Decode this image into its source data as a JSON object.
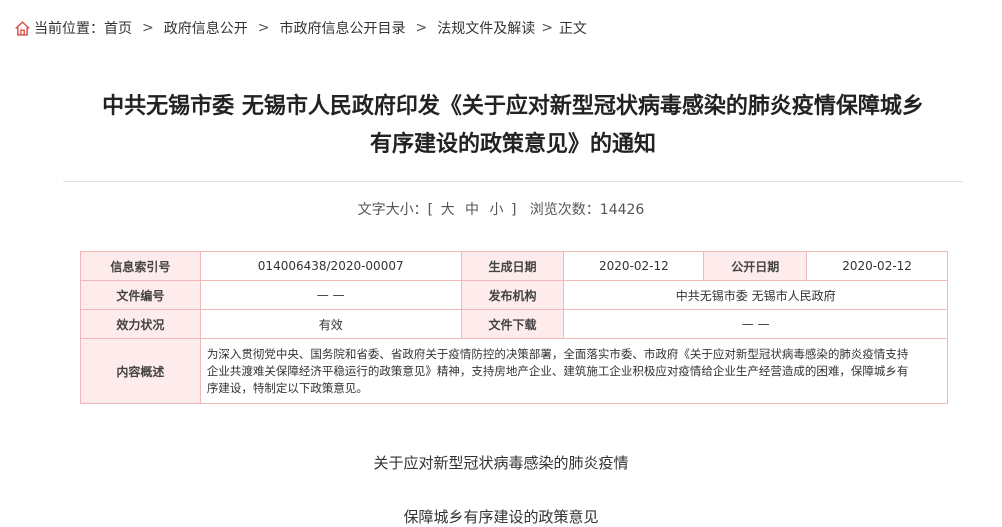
{
  "breadcrumb": {
    "prefix": "当前位置：",
    "items": [
      "首页",
      "政府信息公开",
      "市政府信息公开目录",
      "法规文件及解读",
      "正文"
    ]
  },
  "article": {
    "title_line1": "中共无锡市委 无锡市人民政府印发《关于应对新型冠状病毒感染的肺炎疫情保障城乡",
    "title_line2": "有序建设的政策意见》的通知",
    "font_size_label": "文字大小：[",
    "font_large": "大",
    "font_medium": "中",
    "font_small": "小",
    "font_size_close": "]",
    "views_label": "浏览次数：",
    "views_count": "14426",
    "subtitle1": "关于应对新型冠状病毒感染的肺炎疫情",
    "subtitle2": "保障城乡有序建设的政策意见"
  },
  "info_table": {
    "index_label": "信息索引号",
    "index_value": "014006438/2020-00007",
    "created_label": "生成日期",
    "created_value": "2020-02-12",
    "published_label": "公开日期",
    "published_value": "2020-02-12",
    "doc_no_label": "文件编号",
    "doc_no_value": "— —",
    "issuer_label": "发布机构",
    "issuer_value": "中共无锡市委 无锡市人民政府",
    "status_label": "效力状况",
    "status_value": "有效",
    "download_label": "文件下载",
    "download_value": "— —",
    "summary_label": "内容概述",
    "summary_line1": "为深入贯彻党中央、国务院和省委、省政府关于疫情防控的决策部署，全面落实市委、市政府《关于应对新型冠状病毒感染的肺炎疫情支持",
    "summary_line2": "企业共渡难关保障经济平稳运行的政策意见》精神，支持房地产企业、建筑施工企业积极应对疫情给企业生产经营造成的困难，保障城乡有",
    "summary_line3": "序建设，特制定以下政策意见。"
  },
  "colors": {
    "accent": "#d9534f",
    "table_border": "#f0b8b8",
    "label_bg": "#fdeceb"
  }
}
